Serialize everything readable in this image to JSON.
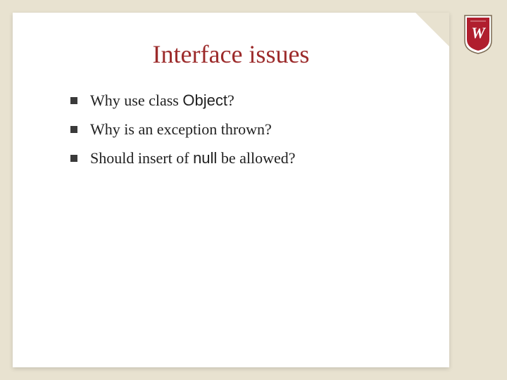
{
  "slide": {
    "title": "Interface issues",
    "bullets": [
      {
        "pre": "Why use class ",
        "code": "Object",
        "post": "?"
      },
      {
        "pre": "Why is an exception thrown?",
        "code": "",
        "post": ""
      },
      {
        "pre": "Should insert of ",
        "code": "null",
        "post": " be allowed?"
      }
    ]
  },
  "logo": {
    "name": "wisconsin-crest"
  }
}
